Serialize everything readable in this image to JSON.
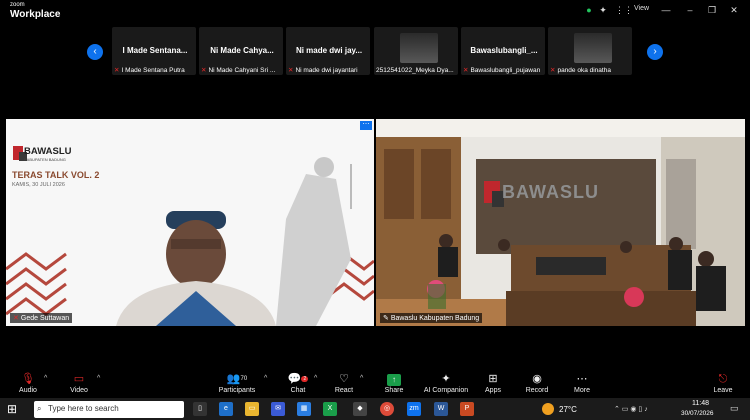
{
  "app": {
    "brand_top": "zoom",
    "brand_main": "Workplace",
    "view_label": "View"
  },
  "gallery": {
    "tiles": [
      {
        "name": "I Made Sentana...",
        "label": "I Made Sentana Putra"
      },
      {
        "name": "Ni Made Cahya...",
        "label": "Ni Made Cahyani Sri ..."
      },
      {
        "name": "Ni made dwi jay...",
        "label": "Ni made dwi jayantari"
      },
      {
        "name": "",
        "label": "2512541022_Meyka Dya..."
      },
      {
        "name": "Bawaslubangli_...",
        "label": "Bawaslubangli_pujawan"
      },
      {
        "name": "",
        "label": "pande oka dinatha"
      }
    ]
  },
  "main": {
    "left": {
      "label": "Gede Suttawan",
      "slide": {
        "org": "BAWASLU",
        "sub": "KABUPATEN BADUNG",
        "title": "TERAS TALK VOL. 2",
        "date": "KAMIS, 30 JULI 2026"
      }
    },
    "right": {
      "label": "Bawaslu Kabupaten Badung",
      "wall_text": "BAWASLU"
    }
  },
  "toolbar": {
    "audio": "Audio",
    "video": "Video",
    "participants": "Participants",
    "participants_count": "70",
    "chat": "Chat",
    "chat_badge": "2",
    "react": "React",
    "share": "Share",
    "ai": "AI Companion",
    "apps": "Apps",
    "record": "Record",
    "more": "More",
    "leave": "Leave"
  },
  "taskbar": {
    "search_placeholder": "Type here to search",
    "temp": "27°C",
    "time": "11:48",
    "date": "30/07/2026"
  },
  "colors": {
    "accent": "#0e72ed",
    "share": "#1a9e4a",
    "mute": "#e02828",
    "leave": "#e02828"
  }
}
